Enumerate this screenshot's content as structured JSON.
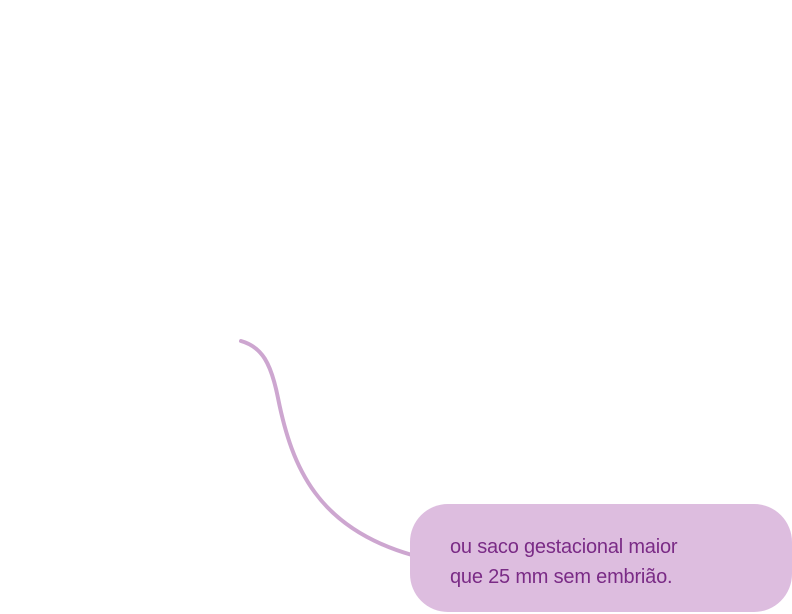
{
  "node": {
    "lines": [
      "ou saco gestacional maior",
      "que 25 mm sem embrião."
    ]
  },
  "colors": {
    "node_fill": "#ddbddf",
    "connector_stroke": "#cda6d0",
    "text": "#7a2b86",
    "background": "#ffffff"
  }
}
